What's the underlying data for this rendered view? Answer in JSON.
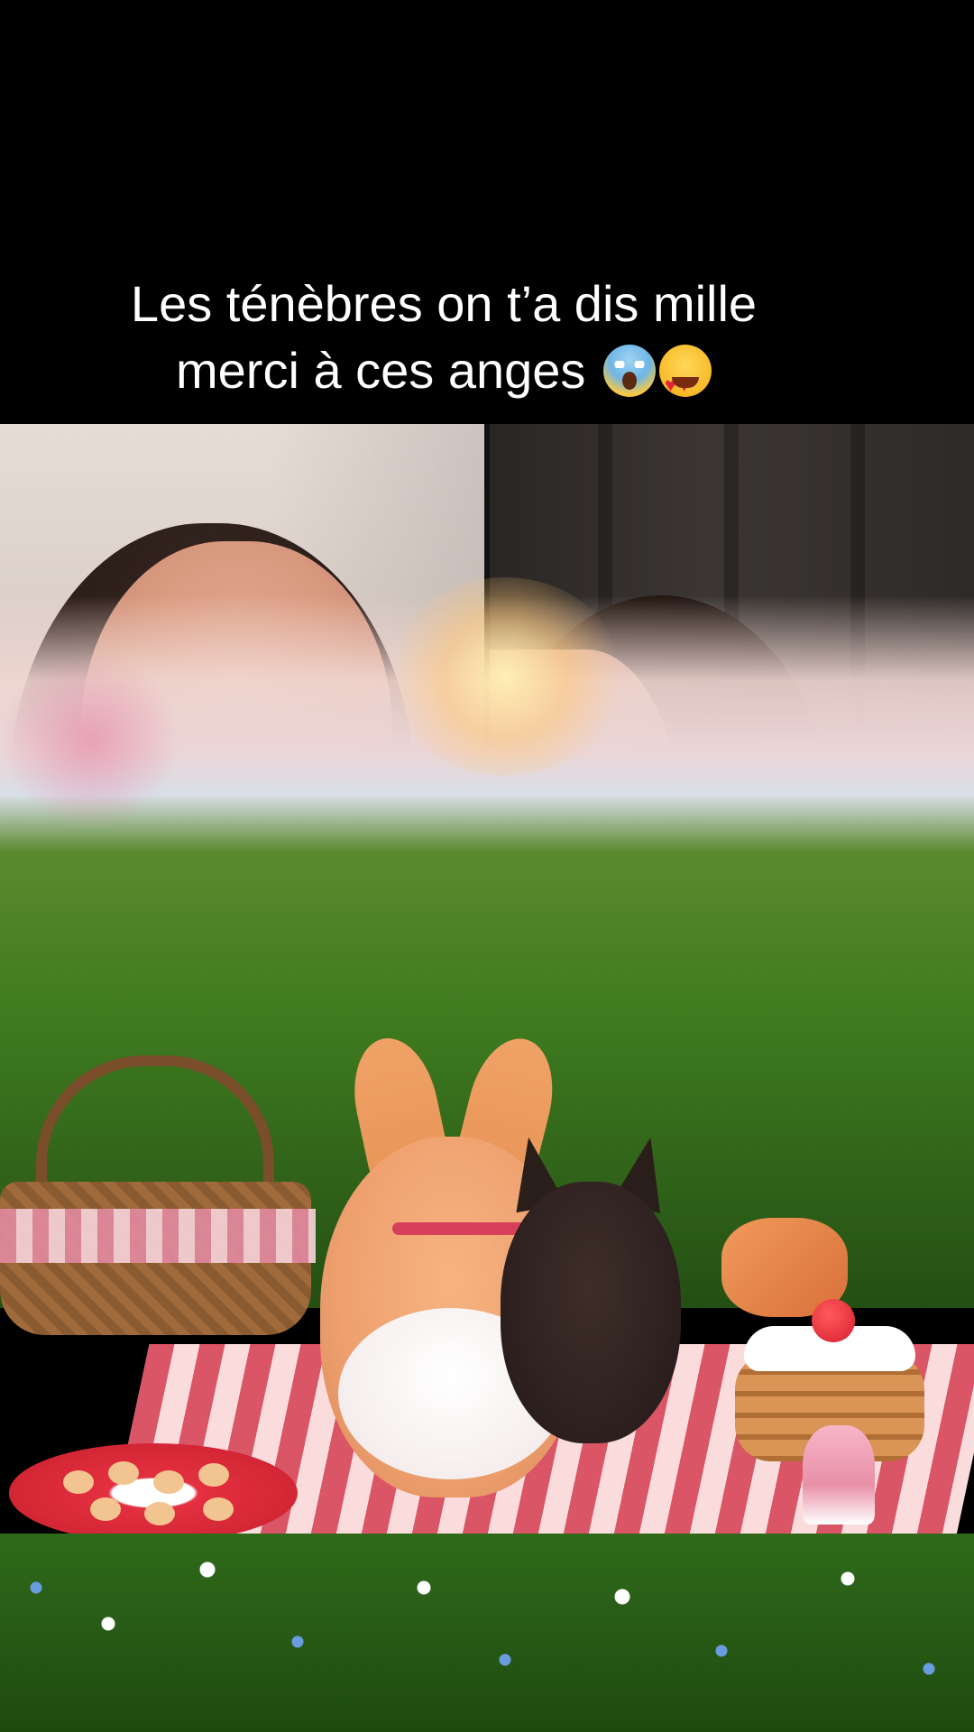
{
  "caption": {
    "line1": "Les ténèbres on t’a dis mille",
    "line2": "merci à ces anges"
  },
  "caption_emojis": [
    "face-screaming-in-fear-icon",
    "smiling-face-with-heart-eyes-icon"
  ],
  "video": {
    "left_panel": "front-camera-view",
    "right_panel": "front-camera-view",
    "effect": "picnic-scene-filter"
  },
  "colors": {
    "background": "#000000",
    "caption_text": "#ffffff"
  }
}
